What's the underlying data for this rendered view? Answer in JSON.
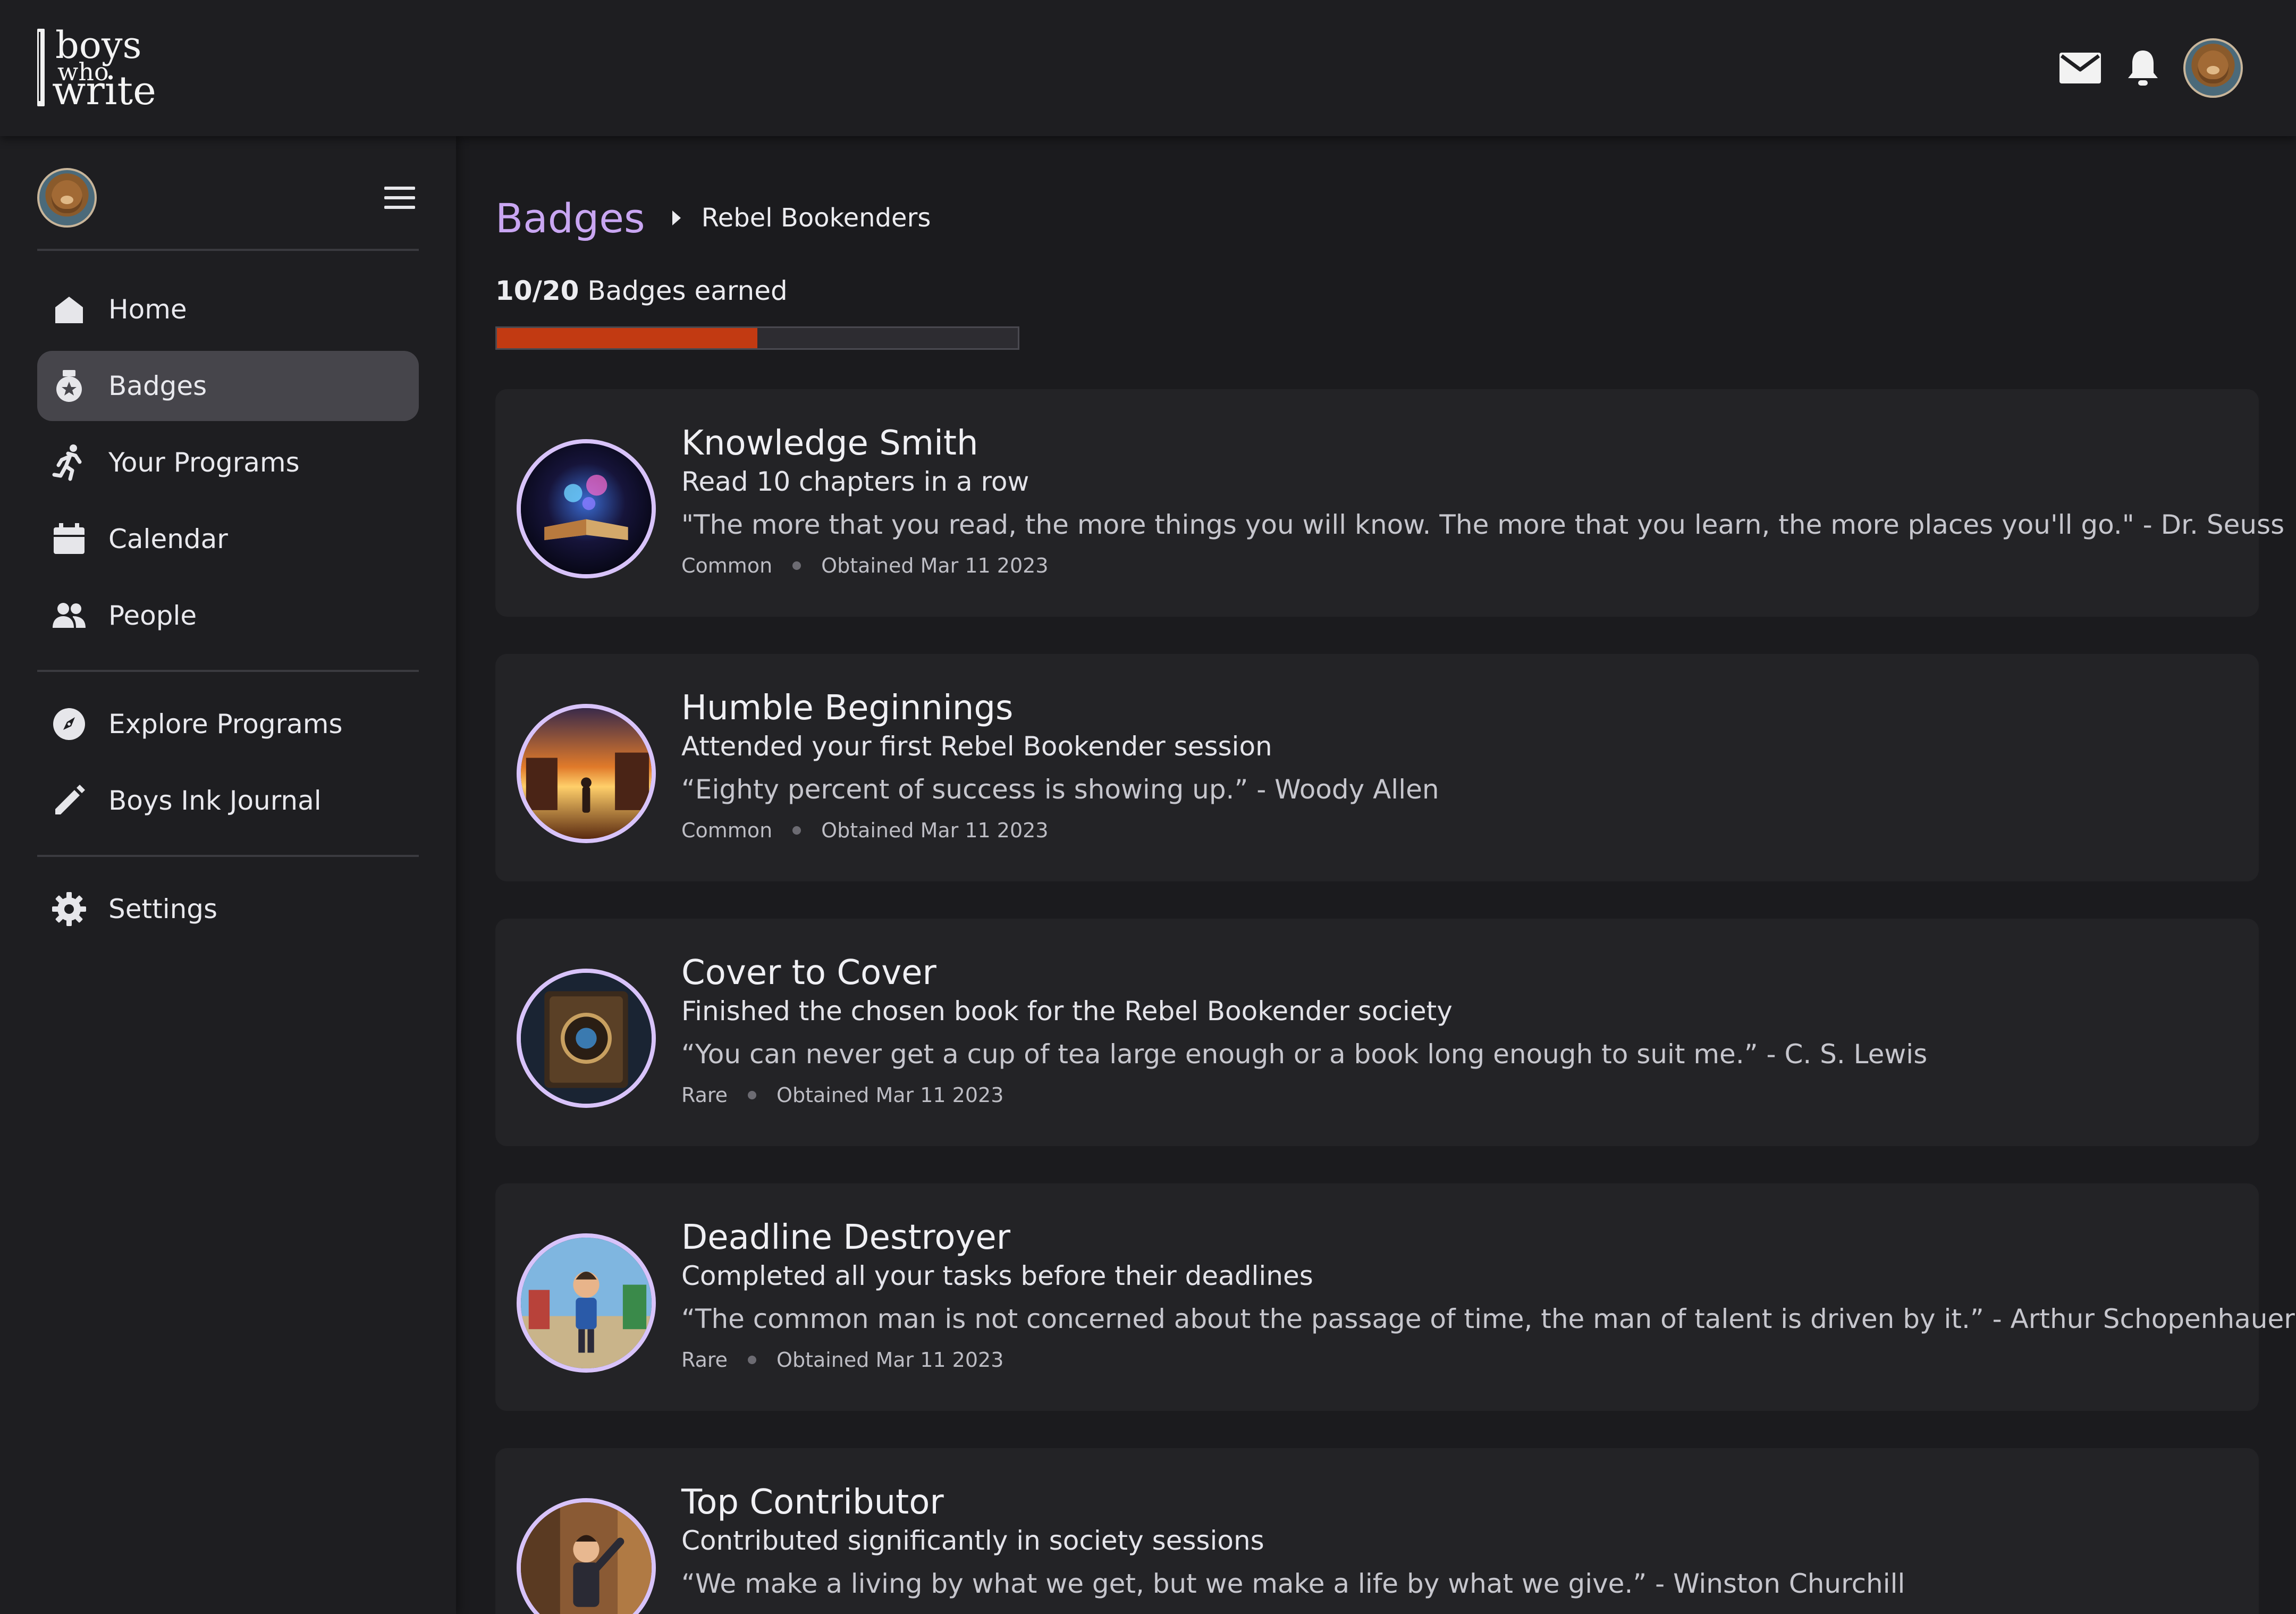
{
  "brand": {
    "logo_line1": "boys",
    "logo_line2": "who",
    "logo_line3": "write"
  },
  "header_icons": [
    "mail-icon",
    "bell-icon",
    "avatar"
  ],
  "sidebar": {
    "primary": [
      {
        "label": "Home",
        "icon": "home-icon",
        "active": false
      },
      {
        "label": "Badges",
        "icon": "badge-icon",
        "active": true
      },
      {
        "label": "Your Programs",
        "icon": "running-person-icon",
        "active": false
      },
      {
        "label": "Calendar",
        "icon": "calendar-icon",
        "active": false
      },
      {
        "label": "People",
        "icon": "people-icon",
        "active": false
      }
    ],
    "secondary": [
      {
        "label": "Explore Programs",
        "icon": "compass-icon"
      },
      {
        "label": "Boys Ink Journal",
        "icon": "pencil-icon"
      }
    ],
    "tertiary": [
      {
        "label": "Settings",
        "icon": "gear-icon"
      }
    ]
  },
  "breadcrumb": {
    "root": "Badges",
    "current": "Rebel Bookenders"
  },
  "progress": {
    "count": "10/20",
    "label": "Badges earned",
    "fraction": 0.5
  },
  "colors": {
    "accent": "#c9a6f2",
    "progress_fill": "#c23a12",
    "badge_ring": "#d8c3fa"
  },
  "badges": [
    {
      "title": "Knowledge Smith",
      "description": "Read 10 chapters in a row",
      "quote": "\"The more that you read, the more things you will know. The more that you learn, the more places you'll go.\" - Dr. Seuss",
      "rarity": "Common",
      "obtained": "Obtained Mar 11 2023"
    },
    {
      "title": "Humble Beginnings",
      "description": "Attended your first Rebel Bookender session",
      "quote": "“Eighty percent of success is showing up.” - Woody Allen",
      "rarity": "Common",
      "obtained": "Obtained Mar 11 2023"
    },
    {
      "title": "Cover to Cover",
      "description": "Finished the chosen book for the Rebel Bookender society",
      "quote": "“You can never get a cup of tea large enough or a book long enough to suit me.” - C. S. Lewis",
      "rarity": "Rare",
      "obtained": "Obtained Mar 11 2023"
    },
    {
      "title": "Deadline Destroyer",
      "description": "Completed all your tasks before their deadlines",
      "quote": "“The common man is not concerned about the passage of time, the man of talent is driven by it.” - Arthur Schopenhauer",
      "rarity": "Rare",
      "obtained": "Obtained Mar 11 2023"
    },
    {
      "title": "Top Contributor",
      "description": "Contributed significantly in society sessions",
      "quote": "“We make a living by what we get, but we make a life by what we give.” - Winston Churchill",
      "rarity": "",
      "obtained": ""
    }
  ]
}
